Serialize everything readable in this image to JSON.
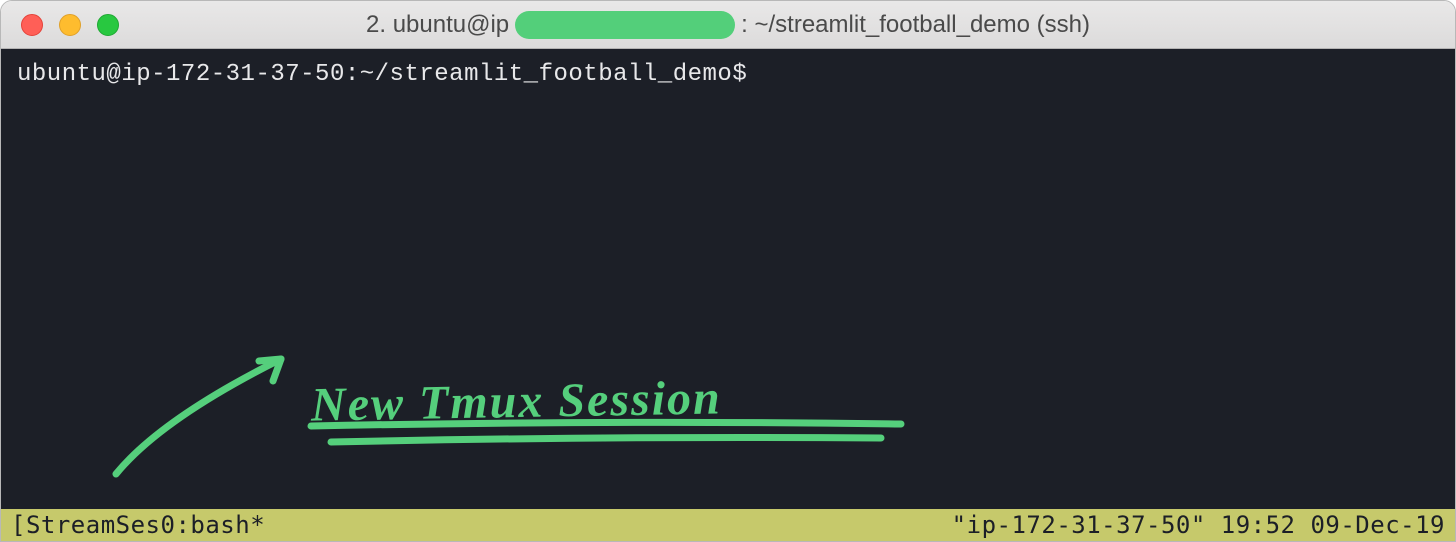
{
  "titlebar": {
    "prefix": "2. ubuntu@ip",
    "suffix": ": ~/streamlit_football_demo (ssh)"
  },
  "terminal": {
    "prompt": "ubuntu@ip-172-31-37-50:~/streamlit_football_demo$"
  },
  "annotation": {
    "text": "New Tmux Session"
  },
  "statusbar": {
    "left": "[StreamSes0:bash*",
    "right": "\"ip-172-31-37-50\" 19:52 09-Dec-19"
  },
  "colors": {
    "terminal_bg": "#1c1f27",
    "terminal_fg": "#e8e8ea",
    "status_bg": "#c6c96b",
    "annotation": "#55cf7c"
  }
}
